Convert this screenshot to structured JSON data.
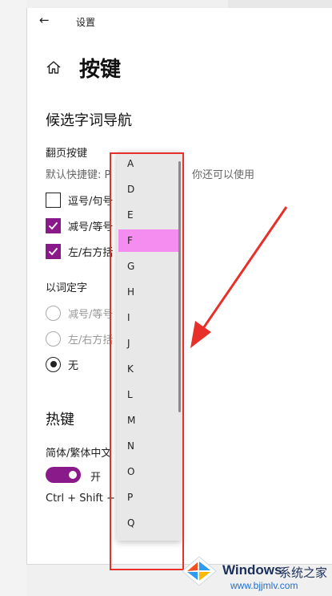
{
  "window": {
    "back_icon": "←",
    "title": "设置"
  },
  "page": {
    "home_icon": "home-icon",
    "title": "按键"
  },
  "candidate_nav": {
    "title": "候选字词导航",
    "page_keys_label": "翻页按键",
    "default_hint": "默认快捷键: P",
    "extra_hint": "你还可以使用",
    "options": [
      {
        "label": "逗号/句号",
        "checked": false
      },
      {
        "label": "减号/等号",
        "checked": true
      },
      {
        "label": "左/右方括",
        "checked": true
      }
    ]
  },
  "word_select": {
    "label": "以词定字",
    "options": [
      {
        "label": "减号/等号",
        "selected": false
      },
      {
        "label": "左/右方括",
        "selected": false
      },
      {
        "label": "无",
        "selected": true
      }
    ]
  },
  "hotkeys": {
    "title": "热键",
    "toggle_label": "简体/繁体中文",
    "toggle_state": "开",
    "toggle_on": true,
    "shortcut": "Ctrl + Shift +"
  },
  "dropdown": {
    "items": [
      "A",
      "D",
      "E",
      "F",
      "G",
      "H",
      "I",
      "J",
      "K",
      "L",
      "M",
      "N",
      "O",
      "P",
      "Q"
    ],
    "selected": "F"
  },
  "watermark": {
    "brand": "Windows",
    "brand_suffix": "系统之家",
    "url": "www.bjjmlv.com"
  },
  "colors": {
    "accent": "#8a1a8a",
    "highlight": "#f58cf0",
    "annotation": "#e8302a"
  }
}
